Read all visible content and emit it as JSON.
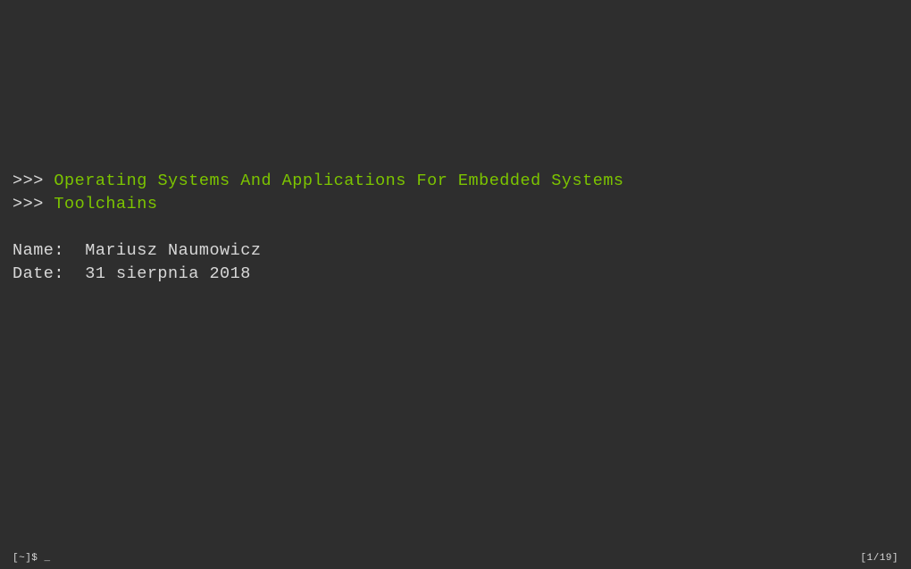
{
  "title": {
    "prompt1": ">>> ",
    "line1": "Operating Systems And Applications For Embedded Systems",
    "prompt2": ">>> ",
    "line2": "Toolchains"
  },
  "meta": {
    "name_label": "Name:  ",
    "name_value": "Mariusz Naumowicz",
    "date_label": "Date:  ",
    "date_value": "31 sierpnia 2018"
  },
  "footer": {
    "left": "[~]$ _",
    "right": "[1/19]"
  }
}
